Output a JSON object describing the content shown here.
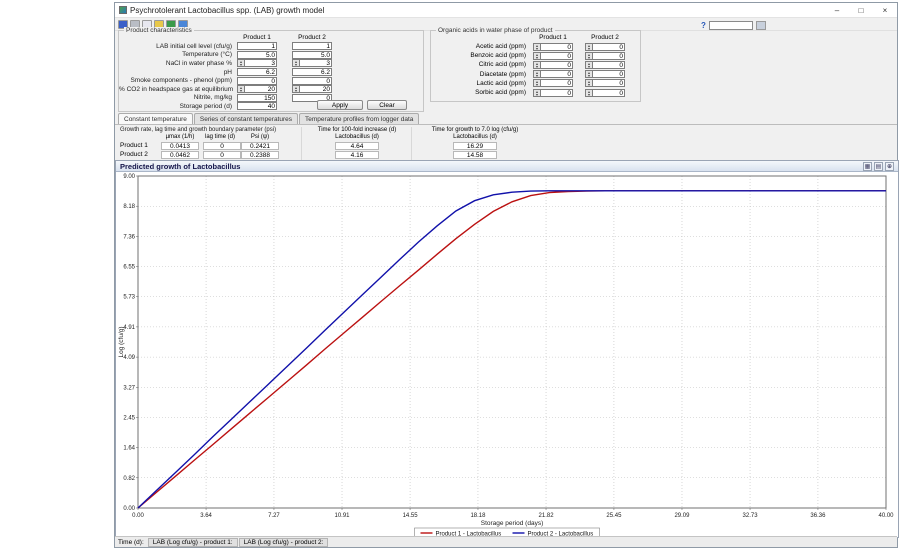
{
  "window": {
    "title": "Psychrotolerant Lactobacillus spp. (LAB) growth model",
    "controls": [
      {
        "name": "minimize",
        "glyph": "–"
      },
      {
        "name": "maximize",
        "glyph": "□"
      },
      {
        "name": "close",
        "glyph": "×"
      }
    ]
  },
  "toolbar": {
    "icons": [
      "save",
      "print",
      "copy",
      "open",
      "export",
      "help"
    ],
    "help_label": "?",
    "input_value": ""
  },
  "ui": {
    "spin_up": "▴",
    "spin_down": "▾"
  },
  "product_characteristics": {
    "title": "Product characteristics",
    "columns": [
      "Product 1",
      "Product 2"
    ],
    "rows": [
      {
        "label": "LAB initial cell level (cfu/g)",
        "p1": "1",
        "p2": "1",
        "spin": false
      },
      {
        "label": "Temperature (°C)",
        "p1": "5.0",
        "p2": "5.0",
        "spin": false
      },
      {
        "label": "NaCl in water phase %",
        "p1": "3",
        "p2": "3",
        "spin": true
      },
      {
        "label": "pH",
        "p1": "6.2",
        "p2": "6.2",
        "spin": false
      },
      {
        "label": "Smoke components - phenol (ppm)",
        "p1": "0",
        "p2": "0",
        "spin": false
      },
      {
        "label": "% CO2 in headspace gas at equilibrium",
        "p1": "20",
        "p2": "20",
        "spin": true
      },
      {
        "label": "Nitrite, mg/kg",
        "p1": "150",
        "p2": "0",
        "spin": false
      },
      {
        "label": "Storage period (d)",
        "p1": "40",
        "p2": null,
        "spin": false
      }
    ]
  },
  "organic_acids": {
    "title": "Organic acids in water phase of product",
    "columns": [
      "Product 1",
      "Product 2"
    ],
    "rows": [
      {
        "label": "Acetic acid (ppm)",
        "p1": "0",
        "p2": "0"
      },
      {
        "label": "Benzoic acid (ppm)",
        "p1": "0",
        "p2": "0"
      },
      {
        "label": "Citric acid (ppm)",
        "p1": "0",
        "p2": "0"
      },
      {
        "label": "Diacetate (ppm)",
        "p1": "0",
        "p2": "0"
      },
      {
        "label": "Lactic acid (ppm)",
        "p1": "0",
        "p2": "0"
      },
      {
        "label": "Sorbic acid (ppm)",
        "p1": "0",
        "p2": "0"
      }
    ],
    "apply_label": "Apply",
    "clear_label": "Clear"
  },
  "temperature_tabs": [
    {
      "label": "Constant temperature",
      "active": true
    },
    {
      "label": "Series of constant temperatures",
      "active": false
    },
    {
      "label": "Temperature profiles from logger data",
      "active": false
    }
  ],
  "results": {
    "growth_header": "Growth rate, lag time and growth boundary parameter (psi)",
    "columns": [
      "µmax (1/h)",
      "lag time (d)",
      "Psi (ψ)"
    ],
    "rows": [
      {
        "label": "Product 1",
        "values": [
          "0.0413",
          "0",
          "0.2421"
        ],
        "t100": "4.64",
        "t7": "16.29"
      },
      {
        "label": "Product 2",
        "values": [
          "0.0462",
          "0",
          "0.2388"
        ],
        "t100": "4.16",
        "t7": "14.58"
      }
    ],
    "t100_header": "Time for 100-fold increase (d)",
    "t100_sub": "Lactobacillus (d)",
    "t7_header": "Time for growth to 7.0 log (cfu/g)",
    "t7_sub": "Lactobacillus (d)"
  },
  "chart": {
    "panel_title": "Predicted growth of Lactobacillus",
    "header_icons": [
      {
        "name": "data-table",
        "glyph": "▦"
      },
      {
        "name": "copy-chart",
        "glyph": "▤"
      },
      {
        "name": "zoom",
        "glyph": "⊕"
      }
    ]
  },
  "chart_data": {
    "type": "line",
    "title": "Predicted growth of Lactobacillus",
    "xlabel": "Storage period (days)",
    "ylabel": "Log (cfu/g)",
    "xlim": [
      0,
      40
    ],
    "ylim": [
      0,
      9
    ],
    "xticks": [
      0,
      3.64,
      7.27,
      10.91,
      14.55,
      18.18,
      21.82,
      25.45,
      29.09,
      32.73,
      36.36,
      40
    ],
    "yticks": [
      0,
      0.82,
      1.64,
      2.45,
      3.27,
      4.09,
      4.91,
      5.73,
      6.55,
      7.36,
      8.18,
      9
    ],
    "grid": true,
    "legend_position": "bottom",
    "series": [
      {
        "name": "Product 1 - Lactobacillus",
        "color": "#bb1111",
        "x": [
          0,
          1,
          2,
          3,
          4,
          5,
          6,
          7,
          8,
          9,
          10,
          11,
          12,
          13,
          14,
          15,
          16,
          17,
          18,
          19,
          20,
          21,
          22,
          23,
          24,
          25,
          26,
          27,
          28,
          29,
          30,
          31,
          32,
          33,
          34,
          35,
          36,
          37,
          38,
          39,
          40
        ],
        "y": [
          0.0,
          0.43,
          0.86,
          1.29,
          1.72,
          2.15,
          2.58,
          3.01,
          3.44,
          3.87,
          4.31,
          4.74,
          5.17,
          5.6,
          6.03,
          6.45,
          6.88,
          7.3,
          7.69,
          8.04,
          8.3,
          8.47,
          8.55,
          8.58,
          8.59,
          8.6,
          8.6,
          8.6,
          8.6,
          8.6,
          8.6,
          8.6,
          8.6,
          8.6,
          8.6,
          8.6,
          8.6,
          8.6,
          8.6,
          8.6,
          8.6
        ]
      },
      {
        "name": "Product 2 - Lactobacillus",
        "color": "#1111aa",
        "x": [
          0,
          1,
          2,
          3,
          4,
          5,
          6,
          7,
          8,
          9,
          10,
          11,
          12,
          13,
          14,
          15,
          16,
          17,
          18,
          19,
          20,
          21,
          22,
          23,
          24,
          25,
          26,
          27,
          28,
          29,
          30,
          31,
          32,
          33,
          34,
          35,
          36,
          37,
          38,
          39,
          40
        ],
        "y": [
          0.0,
          0.48,
          0.96,
          1.44,
          1.93,
          2.41,
          2.89,
          3.37,
          3.85,
          4.33,
          4.82,
          5.3,
          5.78,
          6.26,
          6.74,
          7.21,
          7.65,
          8.05,
          8.33,
          8.49,
          8.56,
          8.59,
          8.6,
          8.6,
          8.6,
          8.6,
          8.6,
          8.6,
          8.6,
          8.6,
          8.6,
          8.6,
          8.6,
          8.6,
          8.6,
          8.6,
          8.6,
          8.6,
          8.6,
          8.6,
          8.6
        ]
      }
    ]
  },
  "status_bar": {
    "time_label": "Time (d):",
    "tabs": [
      "LAB (Log cfu/g) - product 1:",
      "LAB (Log cfu/g) - product 2:"
    ]
  }
}
